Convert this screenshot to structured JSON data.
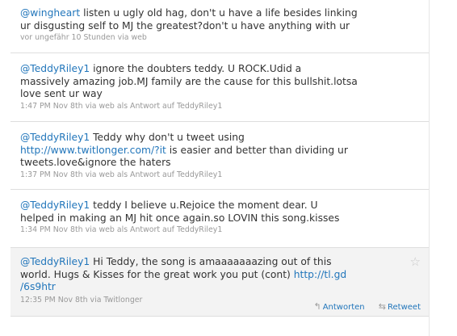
{
  "tweets": [
    {
      "mention": "@wingheart",
      "lines": [
        " listen u ugly old hag, don't u have a life besides linking",
        "ur disgusting self to MJ the greatest?don't u have anything with ur"
      ],
      "meta": "vor ungefähr 10 Stunden via web"
    },
    {
      "mention": "@TeddyRiley1",
      "lines": [
        " ignore the doubters teddy. U ROCK.Udid a",
        "massively amazing job.MJ family are the cause for this bullshit.lotsa",
        "love sent ur way"
      ],
      "meta": "1:47 PM Nov 8th via web als Antwort auf TeddyRiley1"
    },
    {
      "mention": "@TeddyRiley1",
      "line1_rest": " Teddy why don't u tweet using",
      "link": "http://www.twitlonger.com/?it",
      "line2_rest": " is easier and better than dividing ur",
      "line3": "tweets.love&ignore the haters",
      "meta": "1:37 PM Nov 8th via web als Antwort auf TeddyRiley1"
    },
    {
      "mention": "@TeddyRiley1",
      "lines": [
        " teddy I believe u.Rejoice the moment dear. U",
        "helped in making an MJ hit once again.so LOVIN this song.kisses"
      ],
      "meta": "1:34 PM Nov 8th via web als Antwort auf TeddyRiley1"
    },
    {
      "mention": "@TeddyRiley1",
      "line1_rest": " Hi Teddy, the song is amaaaaaaazing out of this",
      "line2_text": "world. Hugs & Kisses for the great work you put (cont) ",
      "link_a": "http://tl.gd",
      "link_b": "/6s9htr",
      "meta": "12:35 PM Nov 8th via Twitlonger",
      "reply_label": "Antworten",
      "retweet_label": "Retweet"
    }
  ],
  "icons": {
    "reply": "reply-arrow-icon",
    "retweet": "retweet-icon",
    "favorite": "star-icon"
  }
}
